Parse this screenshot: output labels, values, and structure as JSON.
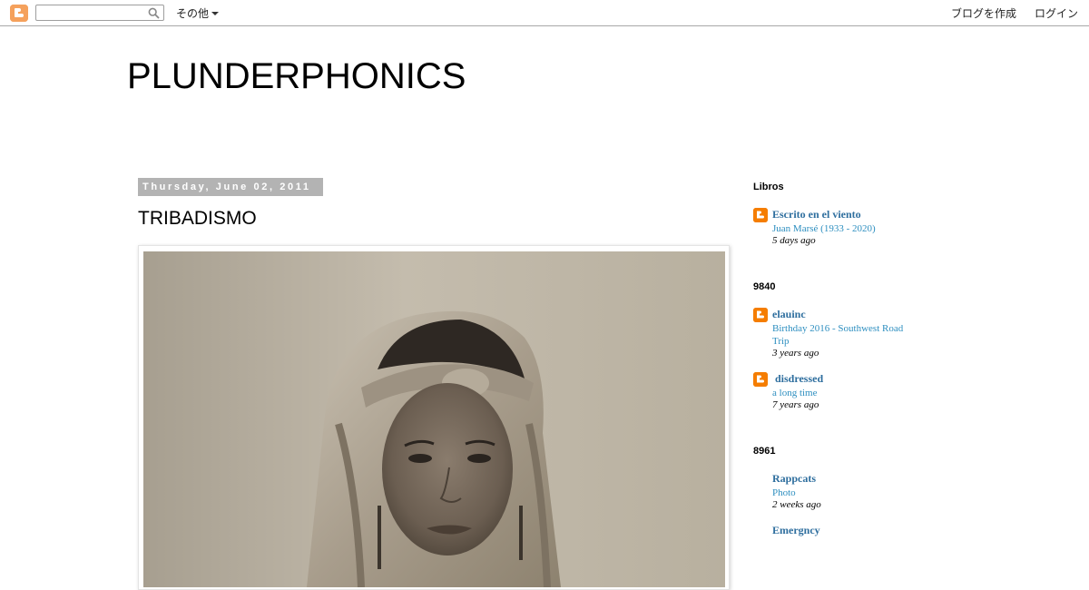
{
  "navbar": {
    "search_placeholder": "",
    "more_label": "その他",
    "create_blog_label": "ブログを作成",
    "login_label": "ログイン",
    "logo_color": "#f5a15c"
  },
  "blog": {
    "title": "PLUNDERPHONICS"
  },
  "post": {
    "date": "Thursday, June 02, 2011",
    "title": "TRIBADISMO"
  },
  "sidebar": {
    "widgets": [
      {
        "title": "Libros",
        "items": [
          {
            "blog_name": "Escrito en el viento",
            "post_title": "Juan Marsé (1933 - 2020)",
            "time": "5 days ago",
            "has_icon": true
          }
        ]
      },
      {
        "title": "9840",
        "items": [
          {
            "blog_name": "elauinc",
            "post_title": "Birthday 2016 - Southwest Road Trip",
            "time": "3 years ago",
            "has_icon": true
          },
          {
            "blog_name": " disdressed",
            "post_title": "a long time",
            "time": "7 years ago",
            "has_icon": true
          }
        ]
      },
      {
        "title": "8961",
        "items": [
          {
            "blog_name": "Rappcats",
            "post_title": "Photo",
            "time": "2 weeks ago",
            "has_icon": false
          },
          {
            "blog_name": "Emergncy",
            "post_title": "",
            "time": "",
            "has_icon": false
          }
        ]
      }
    ]
  },
  "colors": {
    "link_blue": "#2e6e9e",
    "post_link_blue": "#2e8fc0",
    "date_header_bg": "#b3b3b3",
    "blog_icon_orange": "#f57d00"
  }
}
